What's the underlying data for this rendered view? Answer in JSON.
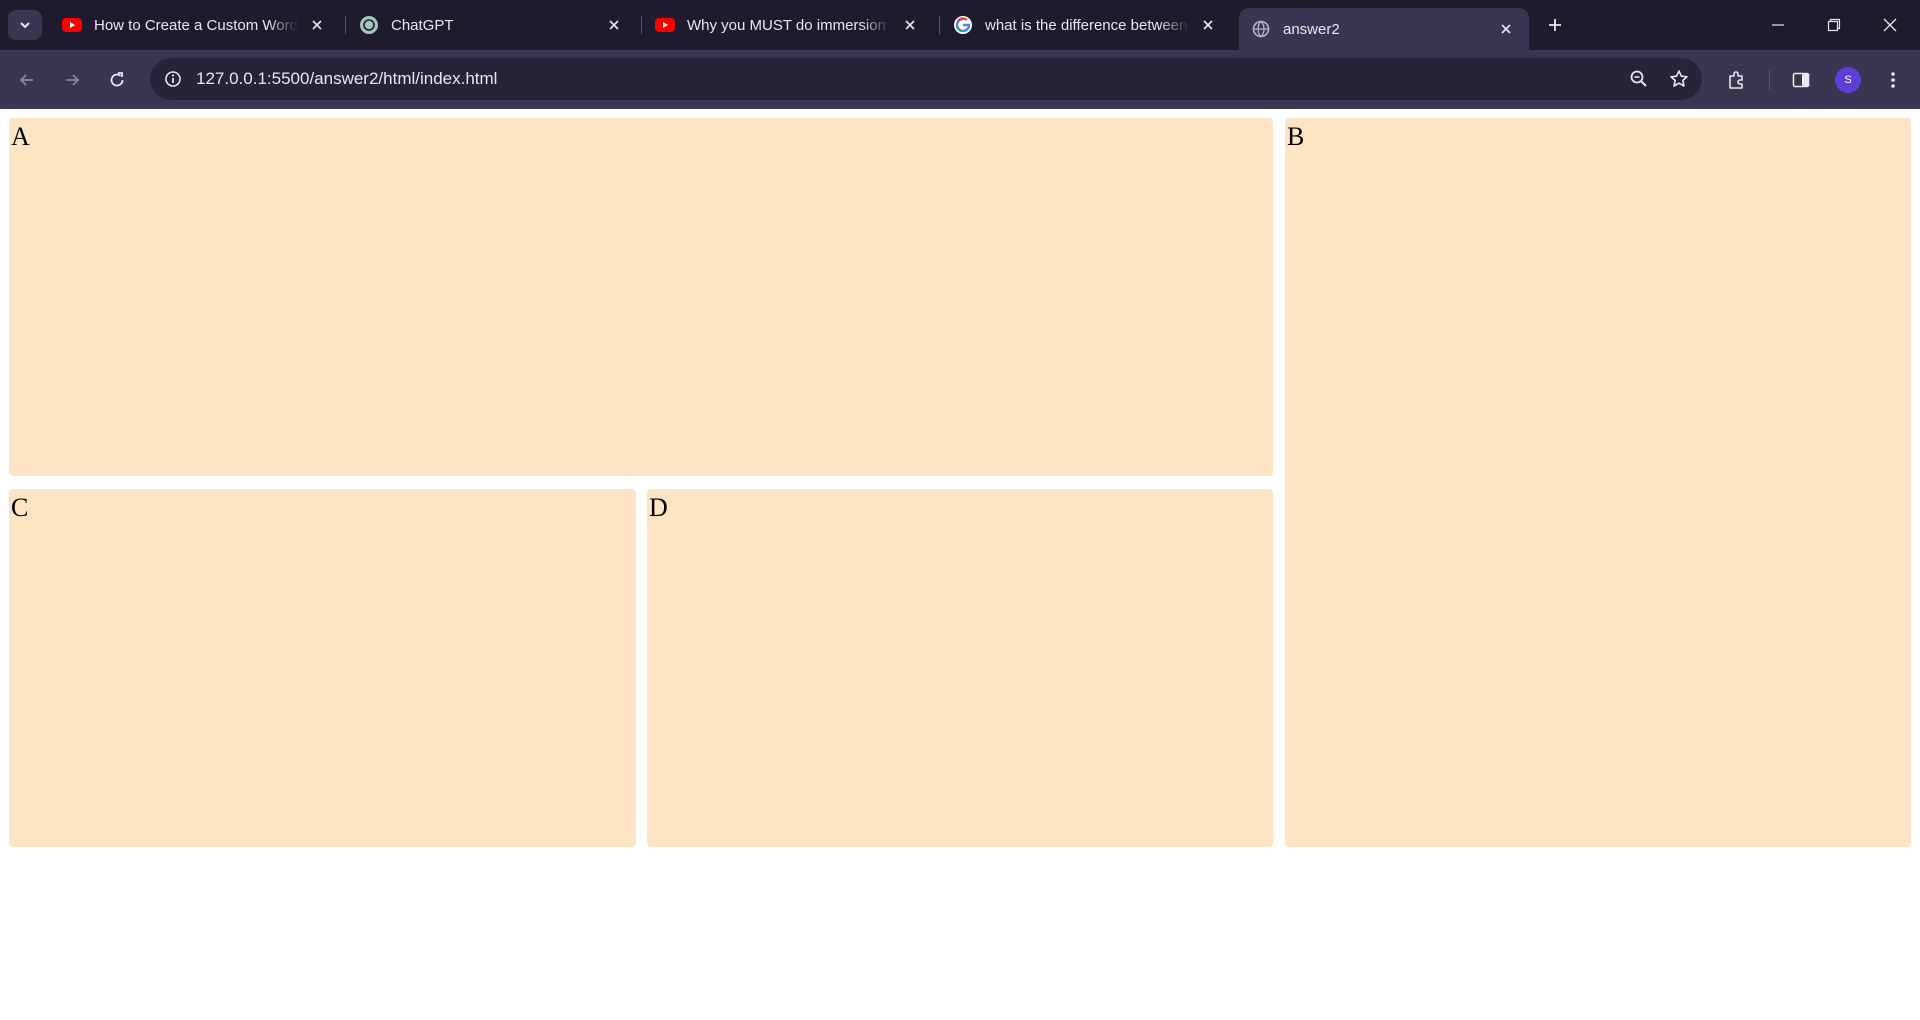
{
  "browser": {
    "tabs": [
      {
        "title": "How to Create a Custom WordPress",
        "favicon": "youtube-icon",
        "active": false
      },
      {
        "title": "ChatGPT",
        "favicon": "chatgpt-icon",
        "active": false
      },
      {
        "title": "Why you MUST do immersion in",
        "favicon": "youtube-icon",
        "active": false
      },
      {
        "title": "what is the difference between p",
        "favicon": "google-icon",
        "active": false
      },
      {
        "title": "answer2",
        "favicon": "globe-icon",
        "active": true
      }
    ],
    "url": "127.0.0.1:5500/answer2/html/index.html",
    "profile_initial": "S",
    "colors": {
      "tabstrip": "#1f1b2e",
      "toolbar": "#3a3550",
      "omnibox": "#27233a",
      "profile": "#5b3fd6"
    }
  },
  "page": {
    "boxes": {
      "a": "A",
      "b": "B",
      "c": "C",
      "d": "D"
    },
    "box_color": "#fde4c4"
  }
}
